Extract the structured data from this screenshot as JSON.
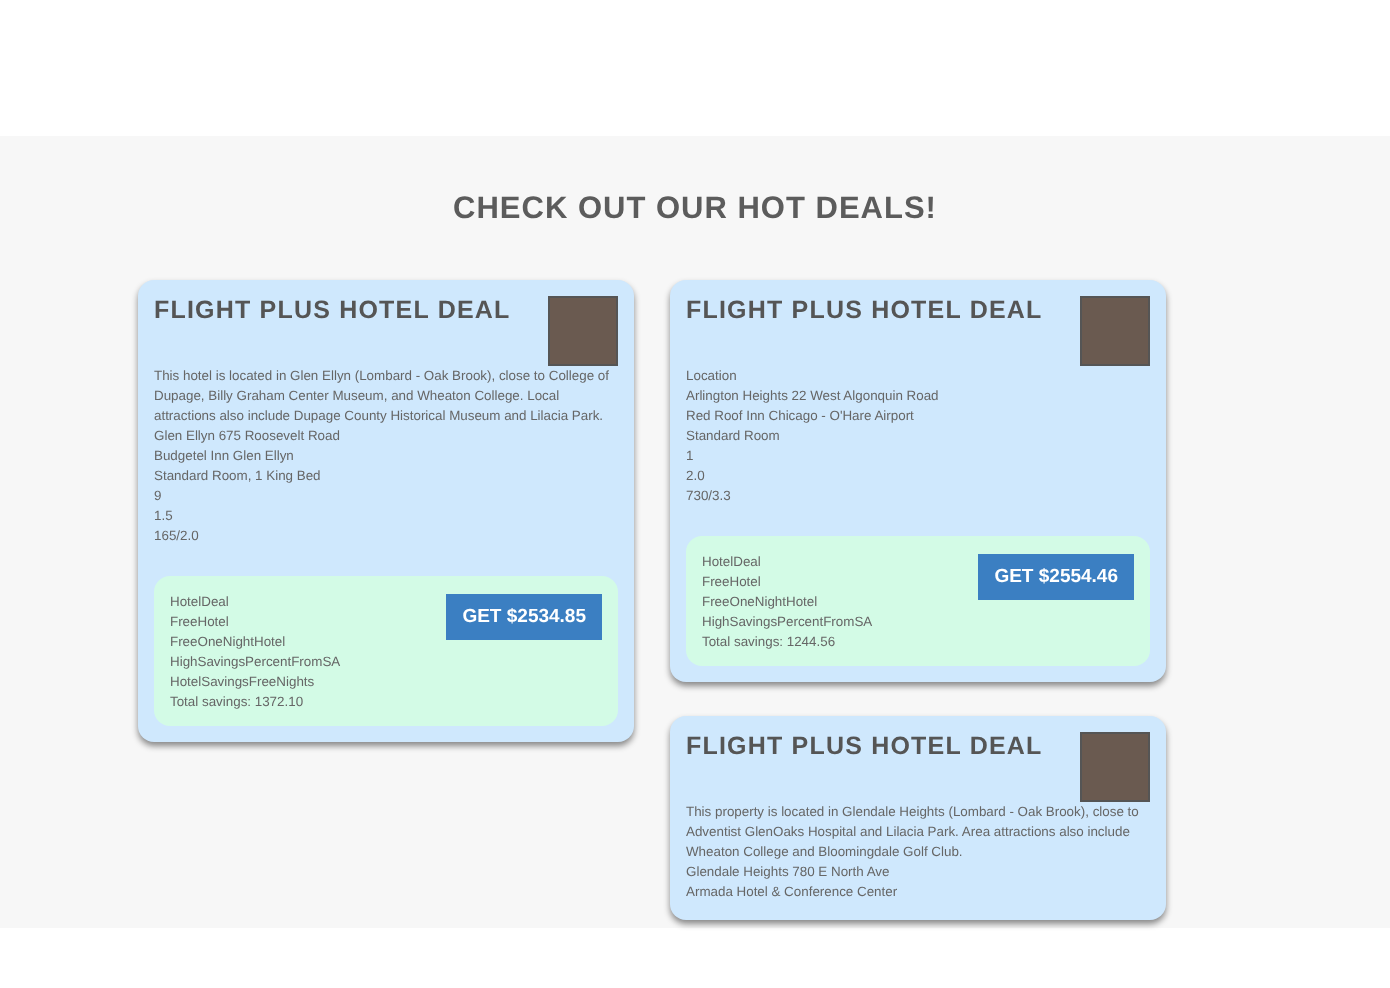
{
  "heading": "CHECK OUT OUR HOT DEALS!",
  "columns": [
    {
      "deals": [
        {
          "title": "FLIGHT PLUS HOTEL DEAL",
          "lines": [
            "This hotel is located in Glen Ellyn (Lombard - Oak Brook), close to College of Dupage, Billy Graham Center Museum, and Wheaton College. Local attractions also include Dupage County Historical Museum and Lilacia Park.",
            "Glen Ellyn 675 Roosevelt Road",
            "Budgetel Inn Glen Ellyn",
            "Standard Room, 1 King Bed",
            "9",
            "1.5",
            "165/2.0"
          ],
          "tags": [
            "HotelDeal",
            "FreeHotel",
            "FreeOneNightHotel",
            "HighSavingsPercentFromSA",
            "HotelSavingsFreeNights",
            "Total savings: 1372.10"
          ],
          "button": "GET $2534.85"
        }
      ]
    },
    {
      "deals": [
        {
          "title": "FLIGHT PLUS HOTEL DEAL",
          "lines": [
            "Location",
            "Arlington Heights 22 West Algonquin Road",
            "Red Roof Inn Chicago - O'Hare Airport",
            "Standard Room",
            "1",
            "2.0",
            "730/3.3"
          ],
          "tags": [
            "HotelDeal",
            "FreeHotel",
            "FreeOneNightHotel",
            "HighSavingsPercentFromSA",
            "Total savings: 1244.56"
          ],
          "button": "GET $2554.46"
        },
        {
          "title": "FLIGHT PLUS HOTEL DEAL",
          "lines": [
            "This property is located in Glendale Heights (Lombard - Oak Brook), close to Adventist GlenOaks Hospital and Lilacia Park. Area attractions also include Wheaton College and Bloomingdale Golf Club.",
            "Glendale Heights 780 E North Ave",
            "Armada Hotel & Conference Center"
          ]
        }
      ]
    }
  ]
}
